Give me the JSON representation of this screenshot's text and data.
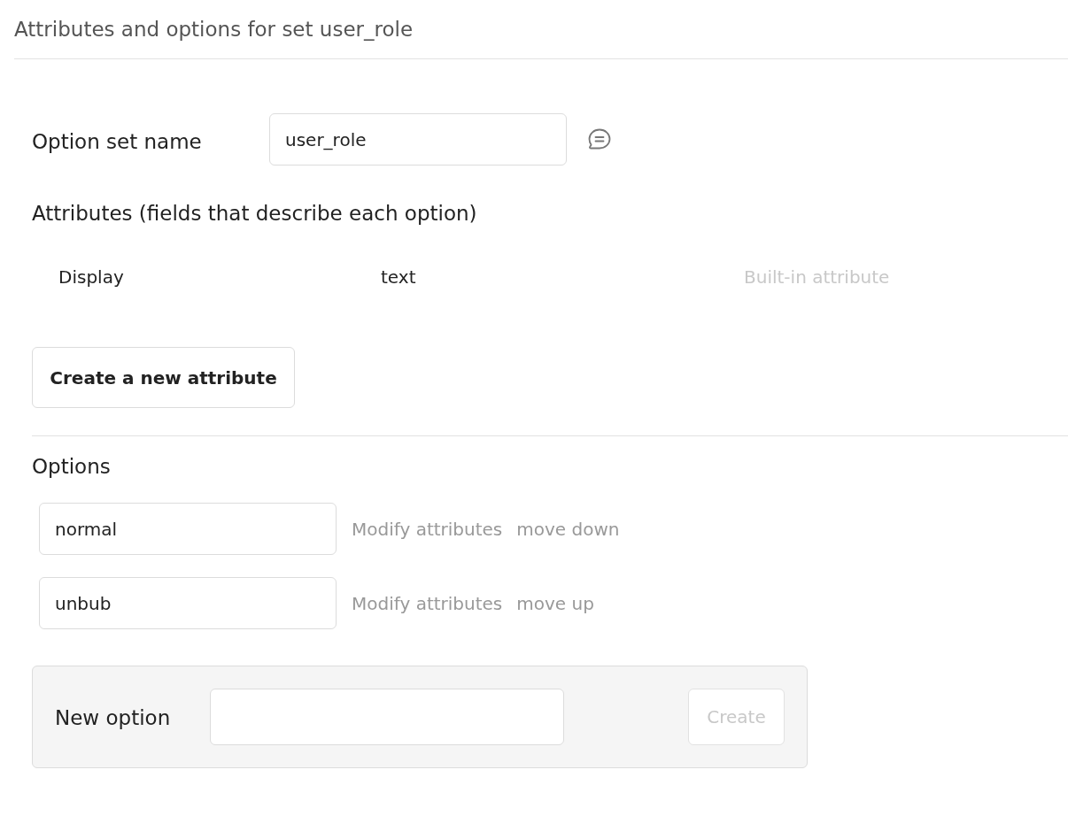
{
  "title": "Attributes and options for set user_role",
  "option_set_name": {
    "label": "Option set name",
    "value": "user_role"
  },
  "attributes": {
    "heading": "Attributes (fields that describe each option)",
    "rows": [
      {
        "name": "Display",
        "type": "text",
        "note": "Built-in attribute"
      }
    ],
    "create_button": "Create a new attribute"
  },
  "options": {
    "heading": "Options",
    "items": [
      {
        "value": "normal",
        "modify": "Modify attributes",
        "move": "move down"
      },
      {
        "value": "unbub",
        "modify": "Modify attributes",
        "move": "move up"
      }
    ]
  },
  "new_option": {
    "label": "New option",
    "button": {
      "label": "Create",
      "disabled": true
    }
  }
}
